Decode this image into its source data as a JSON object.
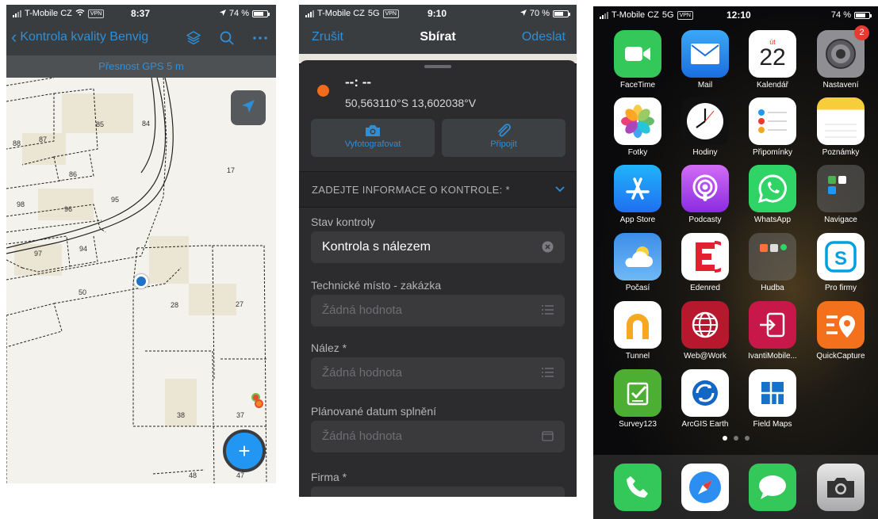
{
  "panel_map": {
    "status": {
      "carrier": "T-Mobile CZ",
      "vpn": "VPN",
      "time": "8:37",
      "battery": "74 %",
      "battery_level": 0.74
    },
    "nav": {
      "back_label": "Kontrola kvality Benvig",
      "icons": [
        "layers-icon",
        "search-icon",
        "more-icon"
      ]
    },
    "gps_banner": "Přesnost GPS 5 m",
    "parcels": [
      "87",
      "85",
      "84",
      "88",
      "86",
      "17",
      "98",
      "96",
      "95",
      "97",
      "94",
      "50",
      "28",
      "27",
      "38",
      "37",
      "48",
      "47"
    ],
    "locate_icon": "location-arrow-icon",
    "fab_label": "+"
  },
  "panel_form": {
    "status": {
      "carrier": "T-Mobile CZ",
      "network": "5G",
      "vpn": "VPN",
      "time": "9:10",
      "battery": "70 %",
      "battery_level": 0.7
    },
    "nav": {
      "cancel": "Zrušit",
      "title": "Sbírat",
      "send": "Odeslat"
    },
    "location": {
      "dash": "--: --",
      "coords": "50,563110°S  13,602038°V",
      "dot_color": "#f26b1d"
    },
    "actions": [
      {
        "label": "Vyfotografovat",
        "icon": "camera-icon"
      },
      {
        "label": "Připojit",
        "icon": "paperclip-icon"
      }
    ],
    "section_title": "ZADEJTE INFORMACE O KONTROLE: *",
    "fields": [
      {
        "label": "Stav kontroly",
        "value": "Kontrola s nálezem",
        "icon": "clear-icon"
      },
      {
        "label": "Technické místo - zakázka",
        "placeholder": "Žádná hodnota",
        "icon": "list-icon"
      },
      {
        "label": "Nález *",
        "placeholder": "Žádná hodnota",
        "icon": "list-icon"
      },
      {
        "label": "Plánované datum splnění",
        "placeholder": "Žádná hodnota",
        "icon": "calendar-icon"
      },
      {
        "label": "Firma *"
      }
    ]
  },
  "panel_home": {
    "status": {
      "carrier": "T-Mobile CZ",
      "network": "5G",
      "vpn": "VPN",
      "time": "12:10",
      "battery": "74 %"
    },
    "apps": [
      {
        "label": "FaceTime",
        "icon": "facetime-icon"
      },
      {
        "label": "Mail",
        "icon": "mail-icon"
      },
      {
        "label": "Kalendář",
        "icon": "calendar-app-icon",
        "day": "út",
        "date": "22"
      },
      {
        "label": "Nastavení",
        "icon": "settings-icon",
        "badge": "2"
      },
      {
        "label": "Fotky",
        "icon": "photos-icon"
      },
      {
        "label": "Hodiny",
        "icon": "clock-icon"
      },
      {
        "label": "Připomínky",
        "icon": "reminders-icon"
      },
      {
        "label": "Poznámky",
        "icon": "notes-icon"
      },
      {
        "label": "App Store",
        "icon": "app-store-icon"
      },
      {
        "label": "Podcasty",
        "icon": "podcasts-icon"
      },
      {
        "label": "WhatsApp",
        "icon": "whatsapp-icon"
      },
      {
        "label": "Navigace",
        "icon": "folder-icon"
      },
      {
        "label": "Počasí",
        "icon": "weather-icon"
      },
      {
        "label": "Edenred",
        "icon": "edenred-icon"
      },
      {
        "label": "Hudba",
        "icon": "folder-icon"
      },
      {
        "label": "Pro firmy",
        "icon": "skype-icon"
      },
      {
        "label": "Tunnel",
        "icon": "tunnel-icon"
      },
      {
        "label": "Web@Work",
        "icon": "web-at-work-icon"
      },
      {
        "label": "IvantiMobile...",
        "icon": "ivanti-icon"
      },
      {
        "label": "QuickCapture",
        "icon": "quickcapture-icon"
      },
      {
        "label": "Survey123",
        "icon": "survey123-icon"
      },
      {
        "label": "ArcGIS Earth",
        "icon": "arcgis-earth-icon"
      },
      {
        "label": "Field Maps",
        "icon": "field-maps-icon"
      }
    ],
    "dock": [
      "phone-icon",
      "safari-icon",
      "messages-icon",
      "camera-app-icon"
    ]
  }
}
